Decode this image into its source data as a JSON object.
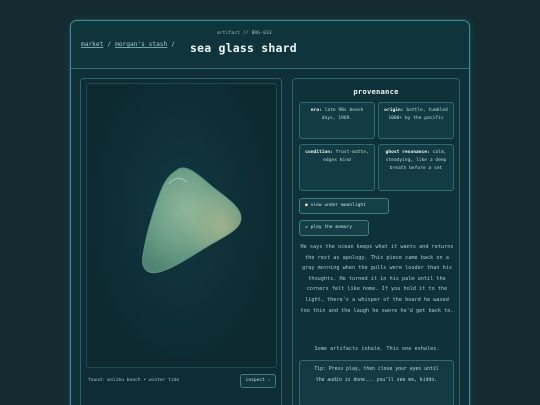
{
  "header": {
    "artifact_id": "artifact // BRG-033",
    "breadcrumb": [
      "market",
      "morgan's stash"
    ],
    "title": "sea glass shard"
  },
  "viewer": {
    "found_label": "found: malibu beach • winter tide",
    "inspect_label": "inspect ›"
  },
  "provenance": {
    "title": "provenance",
    "cards": [
      {
        "label": "era:",
        "value": "late 90s beach days, 1969."
      },
      {
        "label": "origin:",
        "value": "bottle, tumbled 1000+ by the pacific"
      },
      {
        "label": "condition:",
        "value": "frost-matte, edges kind"
      },
      {
        "label": "ghost resonance:",
        "value": "calm, steadying, like a deep breath before a set"
      }
    ],
    "buttons": {
      "moonlight": "view under moonlight",
      "play": "play the memory"
    },
    "story": "He says the ocean keeps what it wants and returns the rest as apology. This piece came back on a gray morning when the gulls were louder than his thoughts. He turned it in his palm until the corners felt like home. If you hold it to the light, there's a whisper of the board he waxed too thin and the laugh he swore he'd get back to.",
    "inhale": "Some artifacts inhale. This one exhales.",
    "tip": "Tip: Press play, then close your eyes until the audio is done... you'll see me, kiddo."
  },
  "colors": {
    "background": "#132b31",
    "panel": "#0f3139",
    "border": "#3d8e92",
    "glass": "#6fa088"
  }
}
